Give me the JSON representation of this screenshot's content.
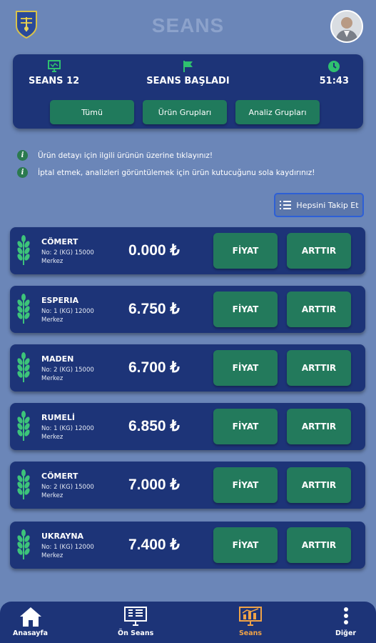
{
  "header": {
    "title": "SEANS"
  },
  "session": {
    "number_label": "SEANS 12",
    "status_label": "SEANS BAŞLADI",
    "time_label": "51:43",
    "filters": [
      {
        "label": "Tümü"
      },
      {
        "label": "Ürün Grupları"
      },
      {
        "label": "Analiz Grupları"
      }
    ]
  },
  "info": {
    "line1": "Ürün detayı için ilgili ürünün üzerine tıklayınız!",
    "line2": "İptal etmek, analizleri görüntülemek için ürün kutucuğunu sola kaydırınız!"
  },
  "follow_all_label": "Hepsini Takip Et",
  "products": [
    {
      "name": "CÖMERT",
      "detail": "No: 2 (KG) 15000",
      "location": "Merkez",
      "price": "0.000 ₺",
      "price_button": "FİYAT",
      "increase_button": "ARTTIR"
    },
    {
      "name": "ESPERIA",
      "detail": "No: 1 (KG) 12000",
      "location": "Merkez",
      "price": "6.750 ₺",
      "price_button": "FİYAT",
      "increase_button": "ARTTIR"
    },
    {
      "name": "MADEN",
      "detail": "No: 2 (KG) 15000",
      "location": "Merkez",
      "price": "6.700 ₺",
      "price_button": "FİYAT",
      "increase_button": "ARTTIR"
    },
    {
      "name": "RUMELİ",
      "detail": "No: 1 (KG) 12000",
      "location": "Merkez",
      "price": "6.850 ₺",
      "price_button": "FİYAT",
      "increase_button": "ARTTIR"
    },
    {
      "name": "CÖMERT",
      "detail": "No: 2 (KG) 15000",
      "location": "Merkez",
      "price": "7.000 ₺",
      "price_button": "FİYAT",
      "increase_button": "ARTTIR"
    },
    {
      "name": "UKRAYNA",
      "detail": "No: 1 (KG) 12000",
      "location": "Merkez",
      "price": "7.400 ₺",
      "price_button": "FİYAT",
      "increase_button": "ARTTIR"
    }
  ],
  "tabs": [
    {
      "label": "Anasayfa",
      "icon": "home-icon"
    },
    {
      "label": "Ön Seans",
      "icon": "monitor-icon"
    },
    {
      "label": "Seans",
      "icon": "chart-screen-icon",
      "active": true
    },
    {
      "label": "Diğer",
      "icon": "more-vertical-icon"
    }
  ],
  "colors": {
    "background": "#6b86b8",
    "card": "#1d3478",
    "button_green": "#237a5c",
    "icon_green": "#29b86b",
    "active_tab": "#f0a347"
  }
}
